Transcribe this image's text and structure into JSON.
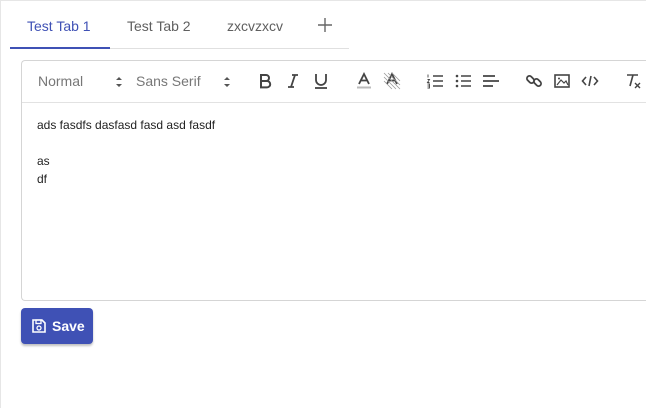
{
  "tabs": [
    {
      "label": "Test Tab 1",
      "active": true
    },
    {
      "label": "Test Tab 2",
      "active": false
    },
    {
      "label": "zxcvzxcv",
      "active": false
    }
  ],
  "tab_add_icon": "plus-icon",
  "toolbar": {
    "size_select": "Normal",
    "font_select": "Sans Serif",
    "buttons": [
      "bold-icon",
      "italic-icon",
      "underline-icon",
      "text-color-icon",
      "background-color-icon",
      "ordered-list-icon",
      "bullet-list-icon",
      "align-icon",
      "link-icon",
      "image-icon",
      "code-icon",
      "clear-format-icon"
    ]
  },
  "editor": {
    "lines": [
      "ads fasdfs dasfasd fasd asd fasdf",
      "",
      "as",
      "df"
    ]
  },
  "save_button": {
    "label": "Save",
    "icon": "save-icon"
  },
  "colors": {
    "accent": "#3f51b5",
    "text": "#222222",
    "muted": "#5f5f5f"
  }
}
